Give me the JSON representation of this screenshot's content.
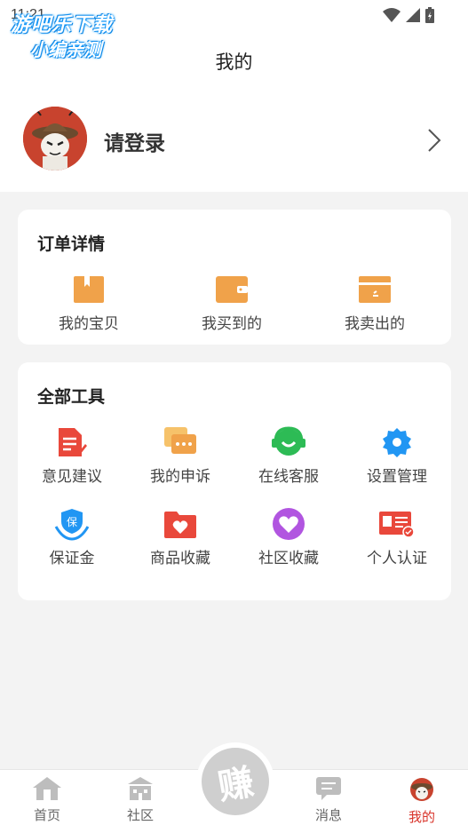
{
  "status": {
    "time": "11:21"
  },
  "watermark": {
    "line1": "游吧乐下载",
    "line2": "小编亲测"
  },
  "header": {
    "title": "我的"
  },
  "profile": {
    "login_label": "请登录"
  },
  "orders": {
    "title": "订单详情",
    "items": [
      {
        "label": "我的宝贝",
        "icon": "box-icon"
      },
      {
        "label": "我买到的",
        "icon": "wallet-icon"
      },
      {
        "label": "我卖出的",
        "icon": "card-icon"
      }
    ]
  },
  "tools": {
    "title": "全部工具",
    "items": [
      {
        "label": "意见建议",
        "icon": "feedback-icon"
      },
      {
        "label": "我的申诉",
        "icon": "chat-icon"
      },
      {
        "label": "在线客服",
        "icon": "headset-icon"
      },
      {
        "label": "设置管理",
        "icon": "gear-icon"
      },
      {
        "label": "保证金",
        "icon": "deposit-icon"
      },
      {
        "label": "商品收藏",
        "icon": "folder-heart-icon"
      },
      {
        "label": "社区收藏",
        "icon": "heart-circle-icon"
      },
      {
        "label": "个人认证",
        "icon": "id-card-icon"
      }
    ]
  },
  "tabbar": {
    "center_glyph": "赚",
    "tabs": [
      {
        "label": "首页",
        "icon": "home-icon",
        "active": false
      },
      {
        "label": "社区",
        "icon": "community-icon",
        "active": false
      },
      {
        "label": "消息",
        "icon": "message-icon",
        "active": false
      },
      {
        "label": "我的",
        "icon": "mine-avatar-icon",
        "active": true
      }
    ]
  },
  "colors": {
    "accent": "#d9342b",
    "orange": "#f0a24a",
    "green": "#2dbb55",
    "blue": "#2196f3",
    "purple": "#b155e0",
    "red": "#e9483b"
  }
}
